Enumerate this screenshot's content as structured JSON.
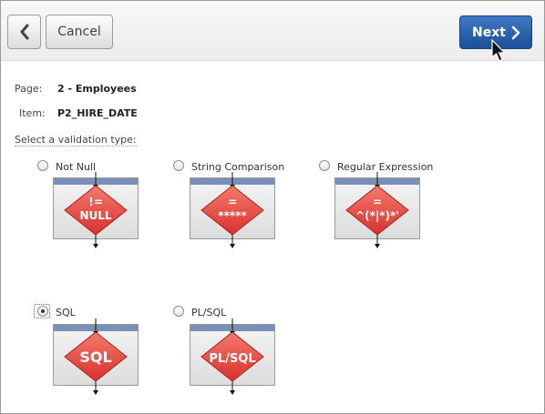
{
  "toolbar": {
    "back_icon": "chevron-left-icon",
    "cancel_label": "Cancel",
    "next_label": "Next",
    "next_icon": "chevron-right-icon"
  },
  "form": {
    "page_label": "Page:",
    "page_value": "2 - Employees",
    "item_label": "Item:",
    "item_value": "P2_HIRE_DATE",
    "prompt": "Select a validation type:"
  },
  "options": [
    {
      "label": "Not Null",
      "icon_text": [
        "!=",
        "NULL"
      ],
      "selected": false
    },
    {
      "label": "String Comparison",
      "icon_text": [
        "=",
        "*****"
      ],
      "selected": false
    },
    {
      "label": "Regular Expression",
      "icon_text": [
        "=",
        "^(*|*)*'"
      ],
      "selected": false
    },
    {
      "label": "SQL",
      "icon_text": [
        "SQL"
      ],
      "selected": true
    },
    {
      "label": "PL/SQL",
      "icon_text": [
        "PL/SQL"
      ],
      "selected": false
    }
  ],
  "colors": {
    "accent": "#2a5da8",
    "diamond": "#d8322e",
    "header_bar": "#7a8fb8"
  }
}
